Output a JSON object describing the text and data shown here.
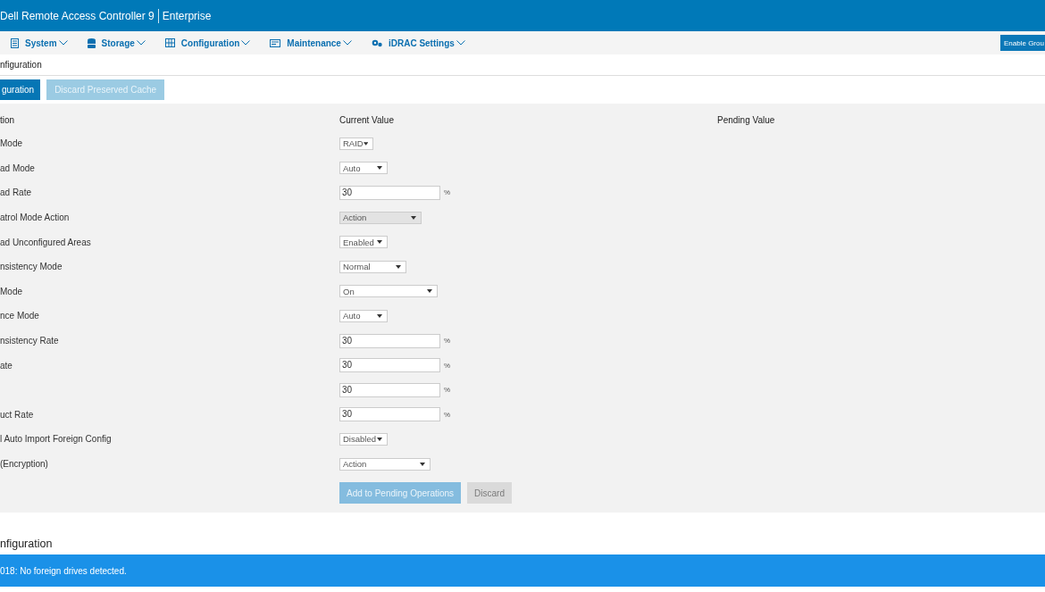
{
  "header": {
    "title": "Dell Remote Access Controller 9",
    "edition": "Enterprise"
  },
  "nav": [
    {
      "label": "System"
    },
    {
      "label": "Storage"
    },
    {
      "label": "Configuration"
    },
    {
      "label": "Maintenance"
    },
    {
      "label": "iDRAC Settings"
    }
  ],
  "nav_button": "Enable Grou",
  "page_title": "nfiguration",
  "actions": [
    {
      "label": "guration",
      "disabled": false
    },
    {
      "label": "Discard Preserved Cache",
      "disabled": true
    }
  ],
  "table": {
    "columns": [
      "tion",
      "Current Value",
      "Pending Value"
    ],
    "rows": [
      {
        "label": "Mode",
        "kind": "select",
        "value": "RAID",
        "disabled": false
      },
      {
        "label": "ad Mode",
        "kind": "select",
        "value": "Auto",
        "disabled": false
      },
      {
        "label": "ad Rate",
        "kind": "text",
        "value": "30",
        "unit": "%"
      },
      {
        "label": "atrol Mode Action",
        "kind": "select",
        "value": "Action",
        "disabled": true
      },
      {
        "label": "ad Unconfigured Areas",
        "kind": "select",
        "value": "Enabled",
        "disabled": false
      },
      {
        "label": "nsistency Mode",
        "kind": "select",
        "value": "Normal",
        "disabled": false
      },
      {
        "label": "Mode",
        "kind": "select",
        "value": "On",
        "disabled": false
      },
      {
        "label": "nce Mode",
        "kind": "select",
        "value": "Auto",
        "disabled": false
      },
      {
        "label": "nsistency Rate",
        "kind": "text",
        "value": "30",
        "unit": "%"
      },
      {
        "label": "ate",
        "kind": "text",
        "value": "30",
        "unit": "%"
      },
      {
        "kind": "text",
        "value": "30",
        "unit": "%"
      },
      {
        "label": "uct Rate",
        "kind": "text",
        "value": "30",
        "unit": "%"
      },
      {
        "label": "l Auto Import Foreign Config",
        "kind": "select",
        "value": "Disabled",
        "disabled": false
      },
      {
        "label": "(Encryption)",
        "kind": "select",
        "value": "Action",
        "disabled": false
      }
    ],
    "buttons": [
      {
        "label": "Add to Pending Operations",
        "kind": "primary",
        "disabled": true
      },
      {
        "label": "Discard",
        "kind": "secondary",
        "disabled": true
      }
    ]
  },
  "section_title": "nfiguration",
  "message": "018: No foreign drives detected."
}
